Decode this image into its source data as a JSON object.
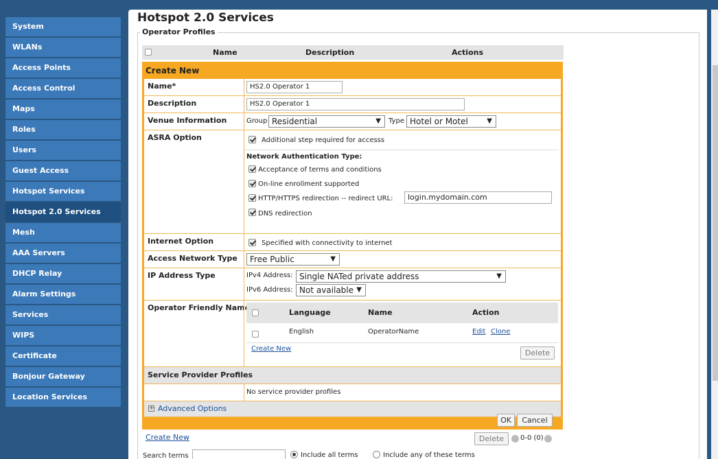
{
  "sidebar": {
    "items": [
      {
        "label": "System"
      },
      {
        "label": "WLANs"
      },
      {
        "label": "Access Points"
      },
      {
        "label": "Access Control"
      },
      {
        "label": "Maps"
      },
      {
        "label": "Roles"
      },
      {
        "label": "Users"
      },
      {
        "label": "Guest Access"
      },
      {
        "label": "Hotspot Services"
      },
      {
        "label": "Hotspot 2.0 Services",
        "active": true
      },
      {
        "label": "Mesh"
      },
      {
        "label": "AAA Servers"
      },
      {
        "label": "DHCP Relay"
      },
      {
        "label": "Alarm Settings"
      },
      {
        "label": "Services"
      },
      {
        "label": "WIPS"
      },
      {
        "label": "Certificate"
      },
      {
        "label": "Bonjour Gateway"
      },
      {
        "label": "Location Services"
      }
    ]
  },
  "page": {
    "title": "Hotspot 2.0 Services",
    "section": "Operator Profiles"
  },
  "table": {
    "headers": {
      "name": "Name",
      "description": "Description",
      "actions": "Actions"
    }
  },
  "create_form": {
    "title": "Create New",
    "name_label": "Name*",
    "name_value": "HS2.0 Operator 1",
    "description_label": "Description",
    "description_value": "HS2.0 Operator 1",
    "venue_label": "Venue Information",
    "group_label": "Group",
    "group_value": "Residential",
    "type_label": "Type",
    "type_value": "Hotel or Motel",
    "asra_label": "ASRA Option",
    "asra_checkbox": "Additional step required for accesss",
    "nat_title": "Network Authentication Type:",
    "nat_opt1": "Acceptance of terms and conditions",
    "nat_opt2": "On-line enrollment supported",
    "nat_opt3": "HTTP/HTTPS redirection -- redirect URL:",
    "redirect_url": "login.mydomain.com",
    "nat_opt4": "DNS redirection",
    "internet_label": "Internet Option",
    "internet_checkbox": "Specified with connectivity to internet",
    "ant_label": "Access Network Type",
    "ant_value": "Free Public",
    "ip_label": "IP Address Type",
    "ipv4_label": "IPv4 Address:",
    "ipv4_value": "Single NATed private address",
    "ipv6_label": "IPv6 Address:",
    "ipv6_value": "Not available",
    "ofn_label": "Operator Friendly Name",
    "ofn_headers": {
      "language": "Language",
      "name": "Name",
      "action": "Action"
    },
    "ofn_row": {
      "language": "English",
      "name": "OperatorName",
      "edit": "Edit",
      "clone": "Clone"
    },
    "ofn_create": "Create New",
    "ofn_delete": "Delete",
    "spp_label": "Service Provider Profiles",
    "spp_empty": "No service provider profiles",
    "advanced": "Advanced Options",
    "ok": "OK",
    "cancel": "Cancel"
  },
  "footer": {
    "create_new": "Create New",
    "delete": "Delete",
    "pager": "0-0 (0)",
    "search_label": "Search terms",
    "radio_all": "Include all terms",
    "radio_any": "Include any of these terms"
  },
  "arrow_glyph": "▼",
  "colors": {
    "sidebar": "#2a5783",
    "sidebar_item": "#3b79b8",
    "accent": "#f6a823"
  }
}
